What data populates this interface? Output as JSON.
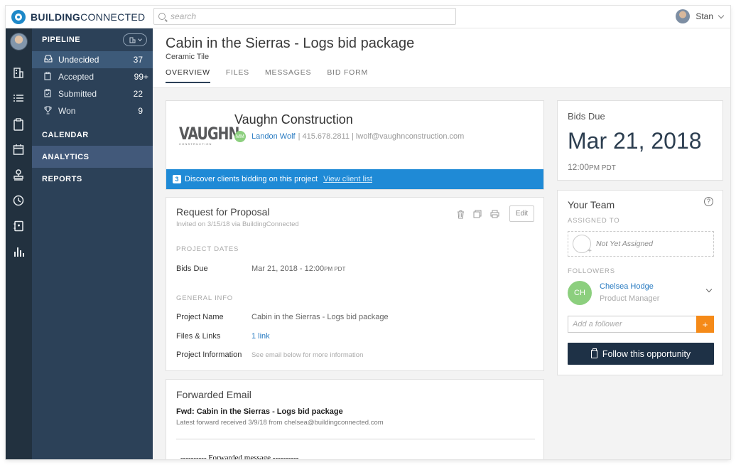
{
  "brand": {
    "name_bold": "BUILDING",
    "name_rest": "CONNECTED",
    "accent": "#1e88c8"
  },
  "search": {
    "placeholder": "search"
  },
  "user": {
    "name": "Stan"
  },
  "nav": {
    "pipeline_label": "PIPELINE",
    "items": [
      {
        "label": "Undecided",
        "count": "37",
        "icon": "inbox-icon"
      },
      {
        "label": "Accepted",
        "count": "99+",
        "icon": "clipboard-icon"
      },
      {
        "label": "Submitted",
        "count": "22",
        "icon": "clipboard-check-icon"
      },
      {
        "label": "Won",
        "count": "9",
        "icon": "trophy-icon"
      }
    ],
    "sections": [
      "CALENDAR",
      "ANALYTICS",
      "REPORTS"
    ]
  },
  "project": {
    "title": "Cabin in the Sierras - Logs bid package",
    "subtitle": "Ceramic Tile",
    "tabs": [
      "OVERVIEW",
      "FILES",
      "MESSAGES",
      "BID FORM"
    ]
  },
  "client": {
    "logo_word": "VAUGHN",
    "logo_sub": "CONSTRUCTION",
    "name": "Vaughn Construction",
    "contact_initials": "MM",
    "contact_name": "Landon Wolf",
    "contact_details": "| 415.678.2811 | lwolf@vaughnconstruction.com",
    "banner_count": "3",
    "banner_text": "Discover clients bidding on this project",
    "banner_link": "View client list"
  },
  "rfp": {
    "title": "Request for Proposal",
    "invited": "Invited on 3/15/18 via BuildingConnected",
    "edit_label": "Edit",
    "project_dates_label": "PROJECT DATES",
    "bids_due_label": "Bids Due",
    "bids_due_value": "Mar 21, 2018 - 12:00",
    "bids_due_suffix": "PM PDT",
    "general_info_label": "GENERAL INFO",
    "project_name_label": "Project Name",
    "project_name_value": "Cabin in the Sierras - Logs bid package",
    "files_label": "Files & Links",
    "files_value": "1 link",
    "info_label": "Project Information",
    "info_value": "See email below for more information"
  },
  "email": {
    "title": "Forwarded Email",
    "subject": "Fwd: Cabin in the Sierras - Logs bid package",
    "meta": "Latest forward received 3/9/18 from chelsea@buildingconnected.com",
    "body_line": "---------- Forwarded message ----------"
  },
  "bids_due": {
    "label": "Bids Due",
    "date": "Mar 21, 2018",
    "time": "12:00",
    "time_suffix": "PM PDT"
  },
  "team": {
    "title": "Your Team",
    "assigned_label": "ASSIGNED TO",
    "not_assigned": "Not Yet Assigned",
    "followers_label": "FOLLOWERS",
    "follower_initials": "CH",
    "follower_name": "Chelsea Hodge",
    "follower_role": "Product Manager",
    "add_placeholder": "Add a follower",
    "follow_button": "Follow this opportunity"
  }
}
